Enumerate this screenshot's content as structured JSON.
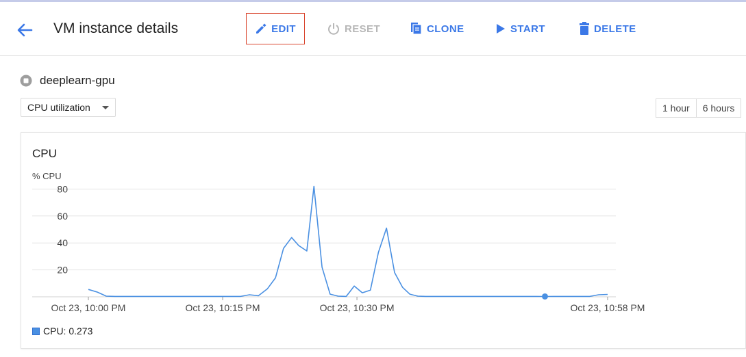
{
  "header": {
    "title": "VM instance details",
    "buttons": {
      "edit": "EDIT",
      "reset": "RESET",
      "clone": "CLONE",
      "start": "START",
      "delete": "DELETE"
    }
  },
  "instance": {
    "name": "deeplearn-gpu"
  },
  "metric_select": {
    "selected": "CPU utilization"
  },
  "time_range": {
    "options": [
      "1 hour",
      "6 hours"
    ]
  },
  "colors": {
    "accent": "#3b78e7",
    "line": "#4a90e2",
    "edit_border": "#d9452e",
    "disabled": "#b7b7b7"
  },
  "chart_data": {
    "type": "line",
    "title": "CPU",
    "ylabel": "% CPU",
    "ylim": [
      0,
      80
    ],
    "yticks": [
      20,
      40,
      60,
      80
    ],
    "grid": true,
    "xlim": [
      0,
      58
    ],
    "xtick_labels": [
      "Oct 23, 10:00 PM",
      "Oct 23, 10:15 PM",
      "Oct 23, 10:30 PM",
      "Oct 23, 10:58 PM"
    ],
    "xtick_minutes": [
      0,
      15,
      30,
      58
    ],
    "series": [
      {
        "name": "CPU",
        "x": [
          0,
          1,
          2,
          3,
          4,
          5,
          6,
          7,
          8,
          9,
          10,
          11,
          12,
          13,
          14,
          15,
          16,
          17,
          18,
          19,
          20,
          20.9,
          21.8,
          22.7,
          23.5,
          24.4,
          25.2,
          26.1,
          27,
          27.9,
          28.8,
          29.7,
          30.6,
          31.5,
          32.4,
          33.3,
          34.2,
          35.1,
          35.9,
          36.8,
          37.7,
          38.6,
          39.5,
          40.4,
          41.2,
          42,
          43,
          44,
          45,
          46,
          47,
          48,
          49,
          50,
          51,
          52,
          53,
          54,
          55,
          56,
          57,
          58
        ],
        "values": [
          5.5,
          3.5,
          0.5,
          0.3,
          0.3,
          0.3,
          0.3,
          0.3,
          0.3,
          0.3,
          0.3,
          0.3,
          0.3,
          0.3,
          0.3,
          0.3,
          0.3,
          0.3,
          1.5,
          0.8,
          6,
          14,
          36,
          44,
          38,
          34,
          82,
          22,
          2,
          0.5,
          0.3,
          8,
          3,
          5,
          33,
          51,
          18,
          7,
          2,
          0.5,
          0.3,
          0.3,
          0.3,
          0.3,
          0.3,
          0.3,
          0.3,
          0.3,
          0.3,
          0.3,
          0.3,
          0.3,
          0.3,
          0.3,
          0.273,
          0.3,
          0.3,
          0.3,
          0.3,
          0.3,
          1.5,
          1.8
        ],
        "highlight_index": 54
      }
    ],
    "legend": {
      "label": "CPU: 0.273",
      "position": "bottom-left"
    }
  }
}
